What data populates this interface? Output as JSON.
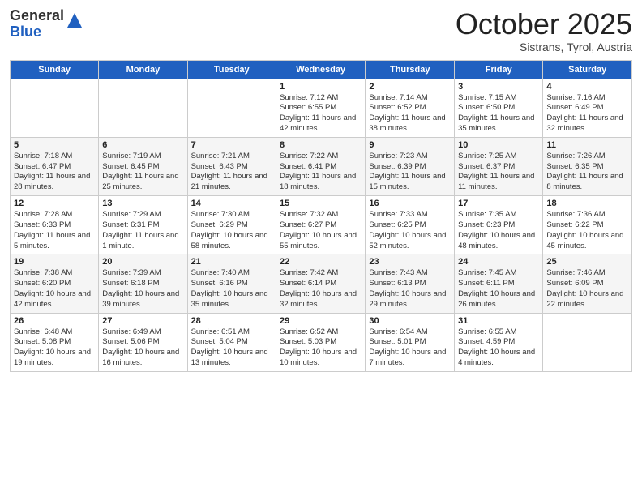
{
  "logo": {
    "line1": "General",
    "line2": "Blue"
  },
  "title": "October 2025",
  "location": "Sistrans, Tyrol, Austria",
  "days_of_week": [
    "Sunday",
    "Monday",
    "Tuesday",
    "Wednesday",
    "Thursday",
    "Friday",
    "Saturday"
  ],
  "weeks": [
    [
      {
        "day": "",
        "info": ""
      },
      {
        "day": "",
        "info": ""
      },
      {
        "day": "",
        "info": ""
      },
      {
        "day": "1",
        "info": "Sunrise: 7:12 AM\nSunset: 6:55 PM\nDaylight: 11 hours and 42 minutes."
      },
      {
        "day": "2",
        "info": "Sunrise: 7:14 AM\nSunset: 6:52 PM\nDaylight: 11 hours and 38 minutes."
      },
      {
        "day": "3",
        "info": "Sunrise: 7:15 AM\nSunset: 6:50 PM\nDaylight: 11 hours and 35 minutes."
      },
      {
        "day": "4",
        "info": "Sunrise: 7:16 AM\nSunset: 6:49 PM\nDaylight: 11 hours and 32 minutes."
      }
    ],
    [
      {
        "day": "5",
        "info": "Sunrise: 7:18 AM\nSunset: 6:47 PM\nDaylight: 11 hours and 28 minutes."
      },
      {
        "day": "6",
        "info": "Sunrise: 7:19 AM\nSunset: 6:45 PM\nDaylight: 11 hours and 25 minutes."
      },
      {
        "day": "7",
        "info": "Sunrise: 7:21 AM\nSunset: 6:43 PM\nDaylight: 11 hours and 21 minutes."
      },
      {
        "day": "8",
        "info": "Sunrise: 7:22 AM\nSunset: 6:41 PM\nDaylight: 11 hours and 18 minutes."
      },
      {
        "day": "9",
        "info": "Sunrise: 7:23 AM\nSunset: 6:39 PM\nDaylight: 11 hours and 15 minutes."
      },
      {
        "day": "10",
        "info": "Sunrise: 7:25 AM\nSunset: 6:37 PM\nDaylight: 11 hours and 11 minutes."
      },
      {
        "day": "11",
        "info": "Sunrise: 7:26 AM\nSunset: 6:35 PM\nDaylight: 11 hours and 8 minutes."
      }
    ],
    [
      {
        "day": "12",
        "info": "Sunrise: 7:28 AM\nSunset: 6:33 PM\nDaylight: 11 hours and 5 minutes."
      },
      {
        "day": "13",
        "info": "Sunrise: 7:29 AM\nSunset: 6:31 PM\nDaylight: 11 hours and 1 minute."
      },
      {
        "day": "14",
        "info": "Sunrise: 7:30 AM\nSunset: 6:29 PM\nDaylight: 10 hours and 58 minutes."
      },
      {
        "day": "15",
        "info": "Sunrise: 7:32 AM\nSunset: 6:27 PM\nDaylight: 10 hours and 55 minutes."
      },
      {
        "day": "16",
        "info": "Sunrise: 7:33 AM\nSunset: 6:25 PM\nDaylight: 10 hours and 52 minutes."
      },
      {
        "day": "17",
        "info": "Sunrise: 7:35 AM\nSunset: 6:23 PM\nDaylight: 10 hours and 48 minutes."
      },
      {
        "day": "18",
        "info": "Sunrise: 7:36 AM\nSunset: 6:22 PM\nDaylight: 10 hours and 45 minutes."
      }
    ],
    [
      {
        "day": "19",
        "info": "Sunrise: 7:38 AM\nSunset: 6:20 PM\nDaylight: 10 hours and 42 minutes."
      },
      {
        "day": "20",
        "info": "Sunrise: 7:39 AM\nSunset: 6:18 PM\nDaylight: 10 hours and 39 minutes."
      },
      {
        "day": "21",
        "info": "Sunrise: 7:40 AM\nSunset: 6:16 PM\nDaylight: 10 hours and 35 minutes."
      },
      {
        "day": "22",
        "info": "Sunrise: 7:42 AM\nSunset: 6:14 PM\nDaylight: 10 hours and 32 minutes."
      },
      {
        "day": "23",
        "info": "Sunrise: 7:43 AM\nSunset: 6:13 PM\nDaylight: 10 hours and 29 minutes."
      },
      {
        "day": "24",
        "info": "Sunrise: 7:45 AM\nSunset: 6:11 PM\nDaylight: 10 hours and 26 minutes."
      },
      {
        "day": "25",
        "info": "Sunrise: 7:46 AM\nSunset: 6:09 PM\nDaylight: 10 hours and 22 minutes."
      }
    ],
    [
      {
        "day": "26",
        "info": "Sunrise: 6:48 AM\nSunset: 5:08 PM\nDaylight: 10 hours and 19 minutes."
      },
      {
        "day": "27",
        "info": "Sunrise: 6:49 AM\nSunset: 5:06 PM\nDaylight: 10 hours and 16 minutes."
      },
      {
        "day": "28",
        "info": "Sunrise: 6:51 AM\nSunset: 5:04 PM\nDaylight: 10 hours and 13 minutes."
      },
      {
        "day": "29",
        "info": "Sunrise: 6:52 AM\nSunset: 5:03 PM\nDaylight: 10 hours and 10 minutes."
      },
      {
        "day": "30",
        "info": "Sunrise: 6:54 AM\nSunset: 5:01 PM\nDaylight: 10 hours and 7 minutes."
      },
      {
        "day": "31",
        "info": "Sunrise: 6:55 AM\nSunset: 4:59 PM\nDaylight: 10 hours and 4 minutes."
      },
      {
        "day": "",
        "info": ""
      }
    ]
  ]
}
